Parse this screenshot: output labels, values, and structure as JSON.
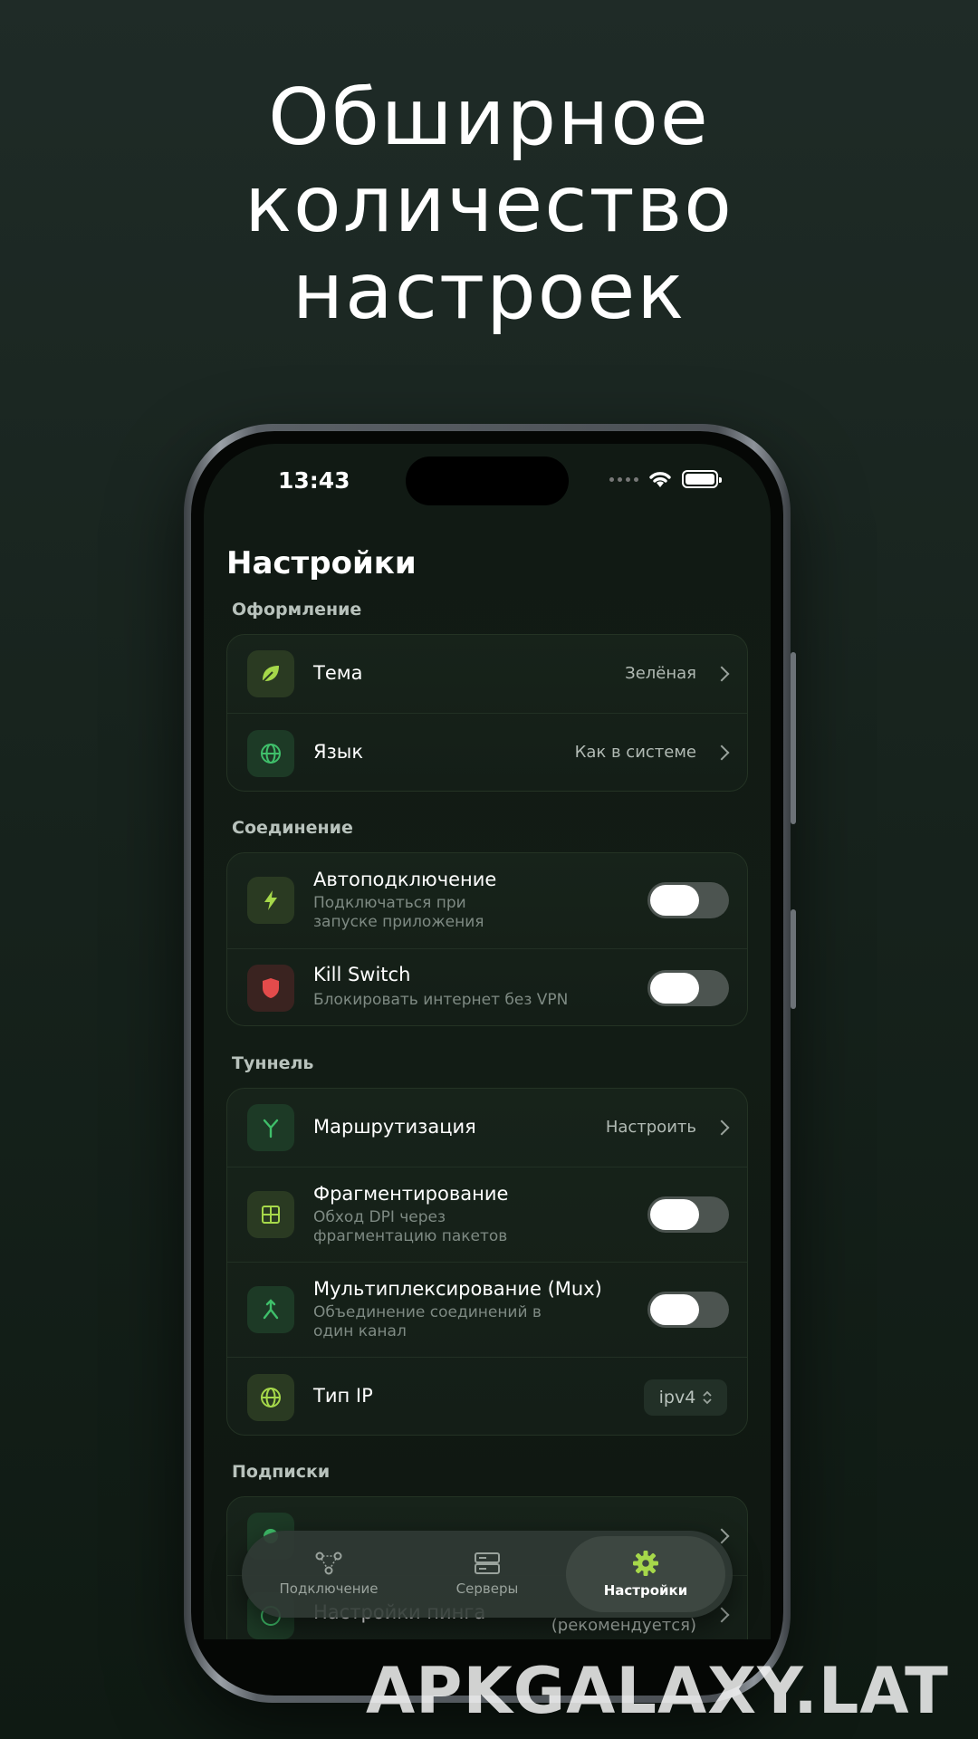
{
  "headline": [
    "Обширное",
    "количество",
    "настроек"
  ],
  "status_bar": {
    "time": "13:43"
  },
  "page_title": "Настройки",
  "sections": {
    "appearance": {
      "label": "Оформление",
      "theme": {
        "title": "Тема",
        "value": "Зелёная"
      },
      "language": {
        "title": "Язык",
        "value": "Как в системе"
      }
    },
    "connection": {
      "label": "Соединение",
      "autoconnect": {
        "title": "Автоподключение",
        "subtitle": "Подключаться при\nзапуске приложения",
        "enabled": false
      },
      "killswitch": {
        "title": "Kill Switch",
        "subtitle": "Блокировать интернет без VPN",
        "enabled": false
      }
    },
    "tunnel": {
      "label": "Туннель",
      "routing": {
        "title": "Маршрутизация",
        "value": "Настроить"
      },
      "fragmentation": {
        "title": "Фрагментирование",
        "subtitle": "Обход DPI через\nфрагментацию пакетов",
        "enabled": false
      },
      "mux": {
        "title": "Мультиплексирование (Mux)",
        "subtitle": "Объединение соединений в\nодин канал",
        "enabled": false
      },
      "ip_type": {
        "title": "Тип IP",
        "value": "ipv4"
      }
    },
    "subscriptions": {
      "label": "Подписки",
      "ping": {
        "title": "Настройки пинга",
        "value": "(рекомендуется)"
      }
    }
  },
  "tabbar": {
    "tabs": [
      {
        "label": "Подключение",
        "icon": "nodes-icon"
      },
      {
        "label": "Серверы",
        "icon": "servers-icon"
      },
      {
        "label": "Настройки",
        "icon": "gear-icon",
        "active": true
      }
    ]
  },
  "watermark": "APKGALAXY.LAT",
  "colors": {
    "accent": "#a6d84a",
    "danger": "#e34b4b",
    "green_icon": "#3fbf6a"
  }
}
